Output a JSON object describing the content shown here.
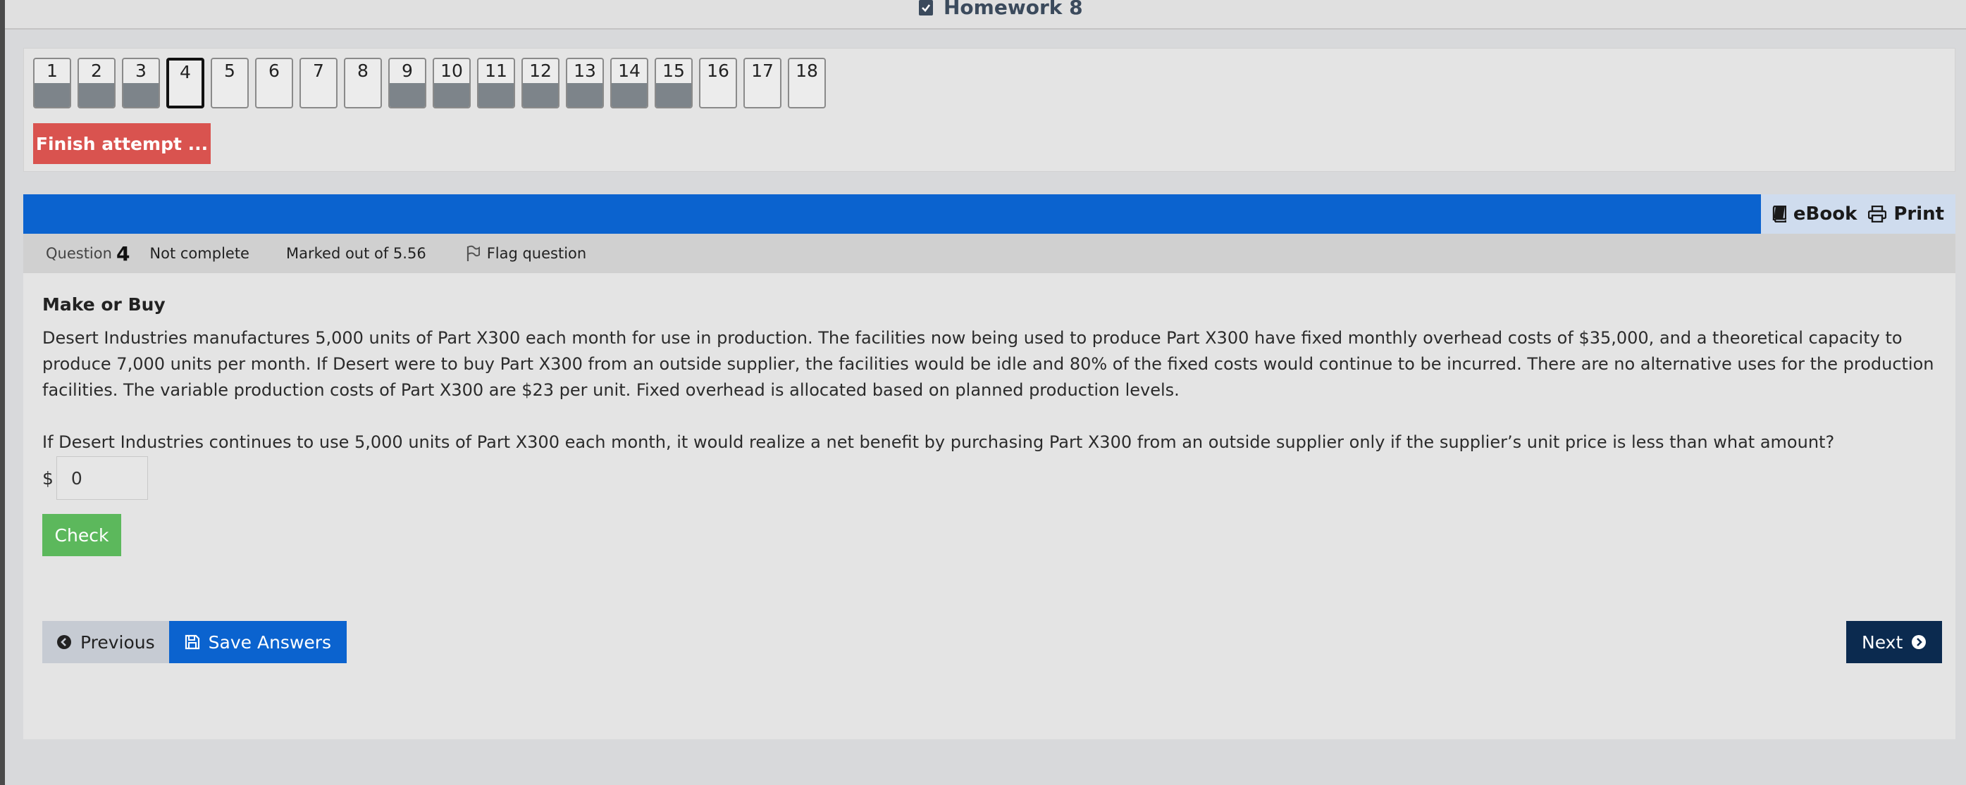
{
  "header": {
    "title": "Homework 8"
  },
  "quiz_nav": {
    "questions": [
      {
        "num": "1",
        "answered": true,
        "current": false
      },
      {
        "num": "2",
        "answered": true,
        "current": false
      },
      {
        "num": "3",
        "answered": true,
        "current": false
      },
      {
        "num": "4",
        "answered": false,
        "current": true
      },
      {
        "num": "5",
        "answered": false,
        "current": false
      },
      {
        "num": "6",
        "answered": false,
        "current": false
      },
      {
        "num": "7",
        "answered": false,
        "current": false
      },
      {
        "num": "8",
        "answered": false,
        "current": false
      },
      {
        "num": "9",
        "answered": true,
        "current": false
      },
      {
        "num": "10",
        "answered": true,
        "current": false
      },
      {
        "num": "11",
        "answered": true,
        "current": false
      },
      {
        "num": "12",
        "answered": true,
        "current": false
      },
      {
        "num": "13",
        "answered": true,
        "current": false
      },
      {
        "num": "14",
        "answered": true,
        "current": false
      },
      {
        "num": "15",
        "answered": true,
        "current": false
      },
      {
        "num": "16",
        "answered": false,
        "current": false
      },
      {
        "num": "17",
        "answered": false,
        "current": false
      },
      {
        "num": "18",
        "answered": false,
        "current": false
      }
    ],
    "finish_label": "Finish attempt ..."
  },
  "toolbar": {
    "ebook_label": "eBook",
    "print_label": "Print"
  },
  "question_info": {
    "label": "Question",
    "number": "4",
    "state": "Not complete",
    "marks": "Marked out of 5.56",
    "flag_label": "Flag question"
  },
  "content": {
    "title": "Make or Buy",
    "paragraph": "Desert Industries manufactures 5,000 units of Part X300 each month for use in production. The facilities now being used to produce Part X300 have fixed monthly overhead costs of $35,000, and a theoretical capacity to produce 7,000 units per month. If Desert were to buy Part X300 from an outside supplier, the facilities would be idle and 80% of the fixed costs would continue to be incurred. There are no alternative uses for the production facilities. The variable production costs of Part X300 are $23 per unit. Fixed overhead is allocated based on planned production levels.",
    "question": "If Desert Industries continues to use 5,000 units of Part X300 each month, it would realize a net benefit by purchasing Part X300 from an outside supplier only if the supplier’s unit price is less than what amount?",
    "currency": "$",
    "answer_value": "0",
    "check_label": "Check"
  },
  "bottom_nav": {
    "previous_label": "Previous",
    "save_label": "Save Answers",
    "next_label": "Next"
  },
  "colors": {
    "accent_blue": "#0b63cf",
    "finish_red": "#d9534f",
    "check_green": "#5cb85c",
    "next_navy": "#0b2a4f",
    "answered_gray": "#7d848a"
  }
}
